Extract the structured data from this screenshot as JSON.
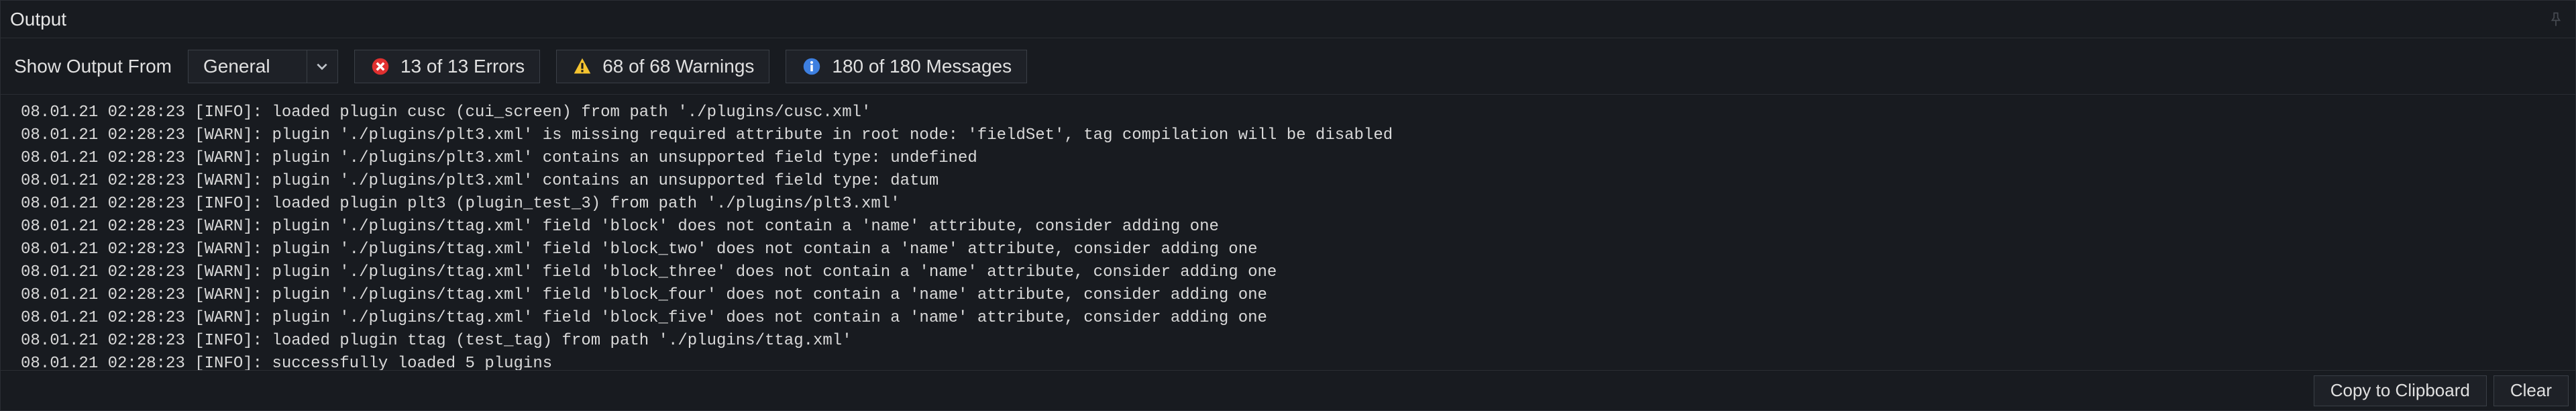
{
  "titlebar": {
    "title": "Output"
  },
  "toolbar": {
    "show_label": "Show Output From",
    "select_value": "General",
    "errors_label": "13 of 13 Errors",
    "warnings_label": "68 of 68 Warnings",
    "messages_label": "180 of 180 Messages"
  },
  "log_lines": [
    "08.01.21 02:28:23 [INFO]: loaded plugin cusc (cui_screen) from path './plugins/cusc.xml'",
    "08.01.21 02:28:23 [WARN]: plugin './plugins/plt3.xml' is missing required attribute in root node: 'fieldSet', tag compilation will be disabled",
    "08.01.21 02:28:23 [WARN]: plugin './plugins/plt3.xml' contains an unsupported field type: undefined",
    "08.01.21 02:28:23 [WARN]: plugin './plugins/plt3.xml' contains an unsupported field type: datum",
    "08.01.21 02:28:23 [INFO]: loaded plugin plt3 (plugin_test_3) from path './plugins/plt3.xml'",
    "08.01.21 02:28:23 [WARN]: plugin './plugins/ttag.xml' field 'block' does not contain a 'name' attribute, consider adding one",
    "08.01.21 02:28:23 [WARN]: plugin './plugins/ttag.xml' field 'block_two' does not contain a 'name' attribute, consider adding one",
    "08.01.21 02:28:23 [WARN]: plugin './plugins/ttag.xml' field 'block_three' does not contain a 'name' attribute, consider adding one",
    "08.01.21 02:28:23 [WARN]: plugin './plugins/ttag.xml' field 'block_four' does not contain a 'name' attribute, consider adding one",
    "08.01.21 02:28:23 [WARN]: plugin './plugins/ttag.xml' field 'block_five' does not contain a 'name' attribute, consider adding one",
    "08.01.21 02:28:23 [INFO]: loaded plugin ttag (test_tag) from path './plugins/ttag.xml'",
    "08.01.21 02:28:23 [INFO]: successfully loaded 5 plugins"
  ],
  "footer": {
    "copy_label": "Copy to Clipboard",
    "clear_label": "Clear"
  }
}
